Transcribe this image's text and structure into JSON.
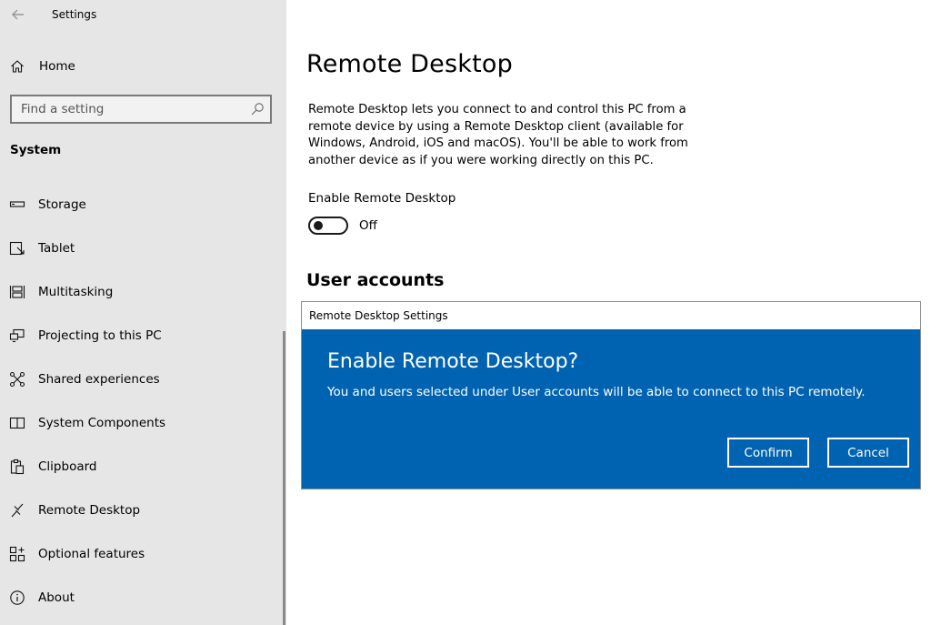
{
  "window": {
    "title": "Settings"
  },
  "sidebar": {
    "home_label": "Home",
    "search_placeholder": "Find a setting",
    "section": "System",
    "items": [
      {
        "label": "Storage",
        "icon": "storage-icon"
      },
      {
        "label": "Tablet",
        "icon": "tablet-icon"
      },
      {
        "label": "Multitasking",
        "icon": "multitasking-icon"
      },
      {
        "label": "Projecting to this PC",
        "icon": "projecting-icon"
      },
      {
        "label": "Shared experiences",
        "icon": "shared-experiences-icon"
      },
      {
        "label": "System Components",
        "icon": "system-components-icon"
      },
      {
        "label": "Clipboard",
        "icon": "clipboard-icon"
      },
      {
        "label": "Remote Desktop",
        "icon": "remote-desktop-icon"
      },
      {
        "label": "Optional features",
        "icon": "optional-features-icon"
      },
      {
        "label": "About",
        "icon": "info-icon"
      }
    ]
  },
  "main": {
    "title": "Remote Desktop",
    "description": "Remote Desktop lets you connect to and control this PC from a remote device by using a Remote Desktop client (available for Windows, Android, iOS and macOS). You'll be able to work from another device as if you were working directly on this PC.",
    "toggle_label": "Enable Remote Desktop",
    "toggle_state": "Off",
    "user_accounts_heading": "User accounts"
  },
  "dialog": {
    "title": "Remote Desktop Settings",
    "heading": "Enable Remote Desktop?",
    "message": "You and users selected under User accounts will be able to connect to this PC remotely.",
    "confirm_label": "Confirm",
    "cancel_label": "Cancel"
  },
  "colors": {
    "sidebar_bg": "#e6e6e6",
    "dialog_bg": "#0063b1",
    "text": "#000000"
  }
}
